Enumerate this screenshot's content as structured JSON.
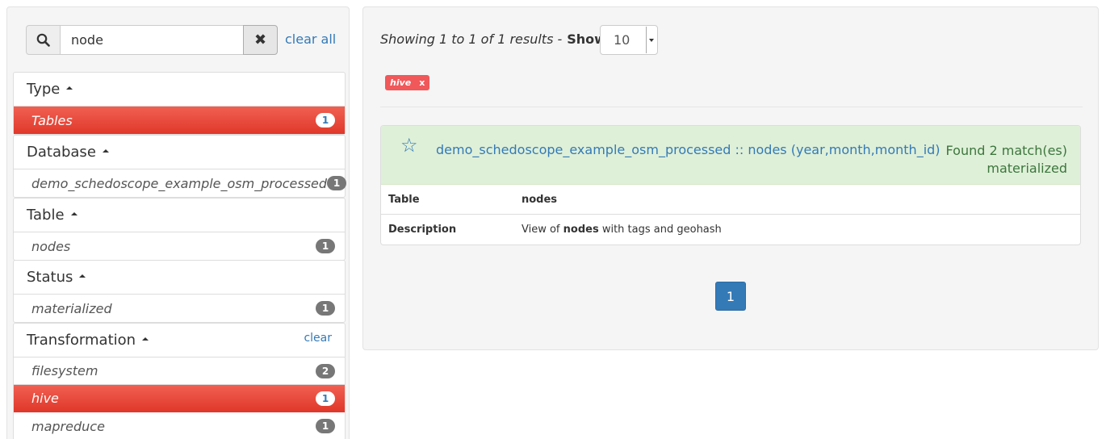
{
  "search": {
    "value": "node",
    "clear_all": "clear all",
    "search_icon": "search-icon",
    "clear_icon": "close-icon",
    "clear_symbol": "✖"
  },
  "facets": {
    "type": {
      "title": "Type",
      "items": [
        {
          "label": "Tables",
          "count": "1",
          "active": true
        }
      ]
    },
    "database": {
      "title": "Database",
      "items": [
        {
          "label": "demo_schedoscope_example_osm_processed",
          "count": "1",
          "active": false
        }
      ]
    },
    "table": {
      "title": "Table",
      "items": [
        {
          "label": "nodes",
          "count": "1",
          "active": false
        }
      ]
    },
    "status": {
      "title": "Status",
      "items": [
        {
          "label": "materialized",
          "count": "1",
          "active": false
        }
      ]
    },
    "transformation": {
      "title": "Transformation",
      "clear": "clear",
      "items": [
        {
          "label": "filesystem",
          "count": "2",
          "active": false
        },
        {
          "label": "hive",
          "count": "1",
          "active": true
        },
        {
          "label": "mapreduce",
          "count": "1",
          "active": false
        }
      ]
    }
  },
  "results_header": {
    "showing_text": "Showing 1 to 1 of 1 results -",
    "show_label": "Show",
    "page_size": "10"
  },
  "active_filter": {
    "label": "hive",
    "remove": "x"
  },
  "result": {
    "star_icon": "star-icon",
    "star_symbol": "☆",
    "title": "demo_schedoscope_example_osm_processed :: nodes (year,month,month_id)",
    "matches": "Found 2 match(es)",
    "status": "materialized",
    "rows": [
      {
        "key": "Table",
        "value": "nodes"
      },
      {
        "key": "Description",
        "value_prefix": "View of ",
        "value_bold": "nodes",
        "value_suffix": " with tags and geohash"
      }
    ]
  },
  "pagination": {
    "current": "1"
  },
  "colors": {
    "accent": "#337ab7",
    "active_facet": "#e8473a",
    "result_header": "#dff0d8",
    "match_text": "#3c763d",
    "filter_tag": "#f0585a"
  }
}
